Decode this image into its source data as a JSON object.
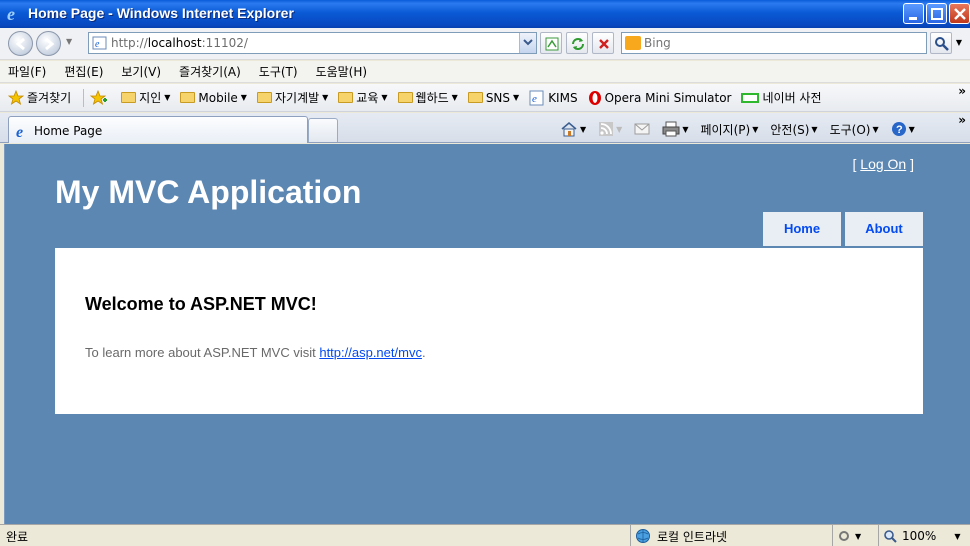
{
  "window": {
    "title": "Home Page - Windows Internet Explorer"
  },
  "address": {
    "url_prefix": "http://",
    "url_host": "localhost",
    "url_suffix": ":11102/"
  },
  "search": {
    "placeholder": "Bing"
  },
  "menubar": {
    "items": [
      "파일(F)",
      "편집(E)",
      "보기(V)",
      "즐겨찾기(A)",
      "도구(T)",
      "도움말(H)"
    ]
  },
  "favorites": {
    "label": "즐겨찾기",
    "items": [
      {
        "label": "지인",
        "icon": "folder-icon",
        "has_menu": true
      },
      {
        "label": "Mobile",
        "icon": "folder-icon",
        "has_menu": true
      },
      {
        "label": "자기계발",
        "icon": "folder-icon",
        "has_menu": true
      },
      {
        "label": "교육",
        "icon": "folder-icon",
        "has_menu": true
      },
      {
        "label": "웹하드",
        "icon": "folder-icon",
        "has_menu": true
      },
      {
        "label": "SNS",
        "icon": "folder-icon",
        "has_menu": true
      },
      {
        "label": "KIMS",
        "icon": "ie-page-icon",
        "has_menu": false
      },
      {
        "label": "Opera Mini Simulator",
        "icon": "opera-icon",
        "has_menu": false
      },
      {
        "label": "네이버 사전",
        "icon": "naver-icon",
        "has_menu": false
      }
    ]
  },
  "tabs": {
    "active_label": "Home Page"
  },
  "commandbar": {
    "page_label": "페이지(P)",
    "safety_label": "안전(S)",
    "tools_label": "도구(O)"
  },
  "site": {
    "login_open": "[ ",
    "login_link": "Log On",
    "login_close": " ]",
    "title": "My MVC Application",
    "nav": [
      "Home",
      "About"
    ],
    "heading": "Welcome to ASP.NET MVC!",
    "body_text": "To learn more about ASP.NET MVC visit ",
    "body_link": "http://asp.net/mvc",
    "body_end": "."
  },
  "status": {
    "text": "완료",
    "zone": "로컬 인트라넷",
    "zoom": "100%"
  },
  "colors": {
    "page_background": "#5c87b2",
    "link": "#034af3",
    "titlebar": "#0a5ad6"
  }
}
